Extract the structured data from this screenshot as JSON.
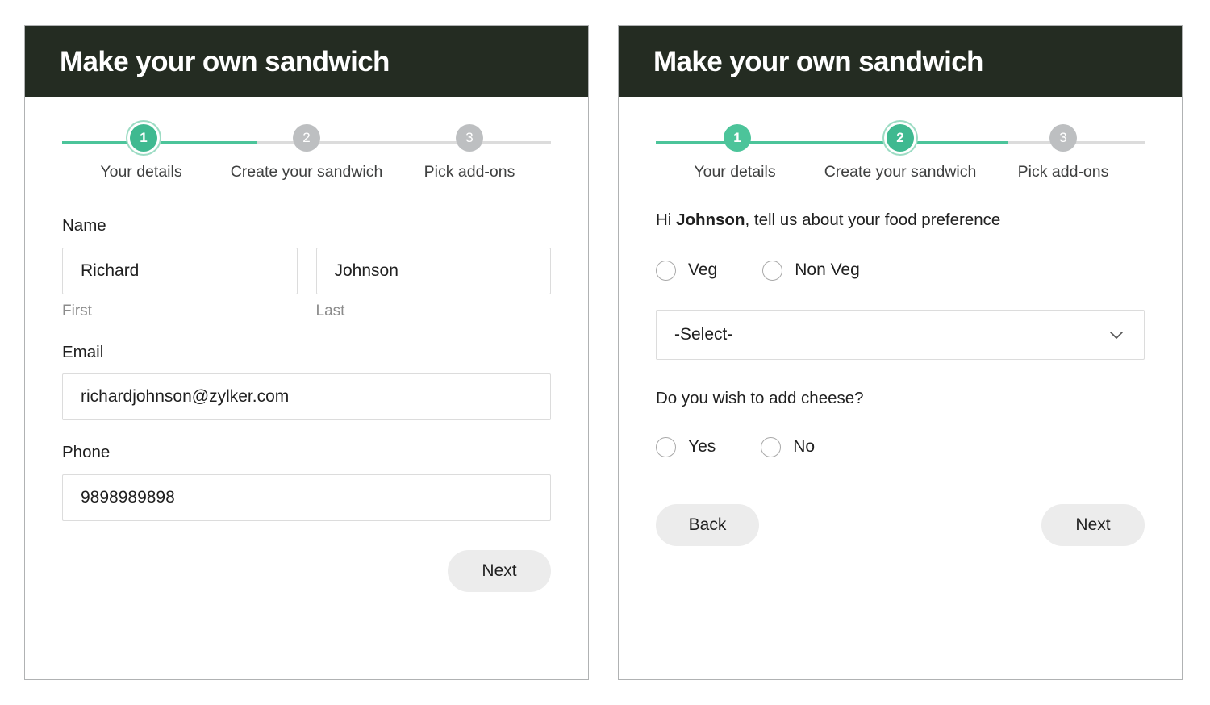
{
  "app": {
    "title": "Make your own sandwich",
    "accent_color": "#4cc49a",
    "header_color": "#242c22",
    "muted_color": "#bdbfc1"
  },
  "steps": [
    {
      "number": "1",
      "label": "Your details"
    },
    {
      "number": "2",
      "label": "Create your sandwich"
    },
    {
      "number": "3",
      "label": "Pick add-ons"
    }
  ],
  "card_one": {
    "title": "Make your own sandwich",
    "active_step": 1,
    "name": {
      "label": "Name",
      "first_value": "Richard",
      "first_hint": "First",
      "last_value": "Johnson",
      "last_hint": "Last"
    },
    "email": {
      "label": "Email",
      "value": "richardjohnson@zylker.com"
    },
    "phone": {
      "label": "Phone",
      "value": "9898989898"
    },
    "next_label": "Next"
  },
  "card_two": {
    "title": "Make your own sandwich",
    "active_step": 2,
    "greeting_prefix": "Hi ",
    "greeting_name": "Johnson",
    "greeting_suffix": ", tell us about your food preference",
    "food_options": [
      {
        "label": "Veg",
        "selected": false
      },
      {
        "label": "Non Veg",
        "selected": false
      }
    ],
    "select": {
      "value": "-Select-",
      "icon": "chevron-down-icon"
    },
    "cheese": {
      "question": "Do you wish to add cheese?",
      "options": [
        {
          "label": "Yes",
          "selected": false
        },
        {
          "label": "No",
          "selected": false
        }
      ]
    },
    "back_label": "Back",
    "next_label": "Next"
  }
}
